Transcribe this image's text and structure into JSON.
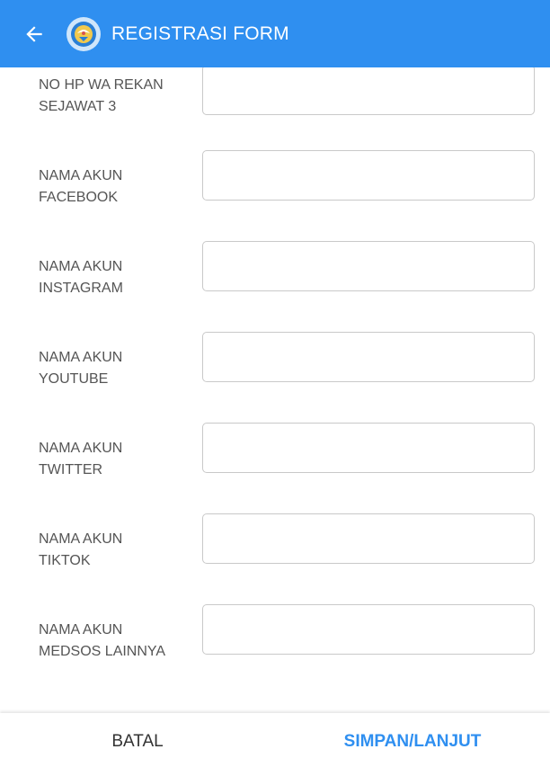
{
  "app_bar": {
    "title": "REGISTRASI FORM",
    "back_icon": "arrow-left-icon",
    "logo_icon": "tut-wuri-handayani-logo",
    "background_color": "#2f8ff0"
  },
  "form": {
    "fields": [
      {
        "label_line1": "NO HP WA REKAN",
        "label_line2": "SEJAWAT 3",
        "value": "",
        "placeholder": ""
      },
      {
        "label_line1": "NAMA AKUN",
        "label_line2": "FACEBOOK",
        "value": "",
        "placeholder": ""
      },
      {
        "label_line1": "NAMA AKUN",
        "label_line2": "INSTAGRAM",
        "value": "",
        "placeholder": ""
      },
      {
        "label_line1": "NAMA AKUN",
        "label_line2": "YOUTUBE",
        "value": "",
        "placeholder": ""
      },
      {
        "label_line1": "NAMA AKUN",
        "label_line2": "TWITTER",
        "value": "",
        "placeholder": ""
      },
      {
        "label_line1": "NAMA AKUN",
        "label_line2": "TIKTOK",
        "value": "",
        "placeholder": ""
      },
      {
        "label_line1": "NAMA AKUN",
        "label_line2": "MEDSOS LAINNYA",
        "value": "",
        "placeholder": ""
      }
    ]
  },
  "footer": {
    "cancel_label": "BATAL",
    "save_label": "SIMPAN/LANJUT",
    "accent_color": "#2f8ff0"
  }
}
